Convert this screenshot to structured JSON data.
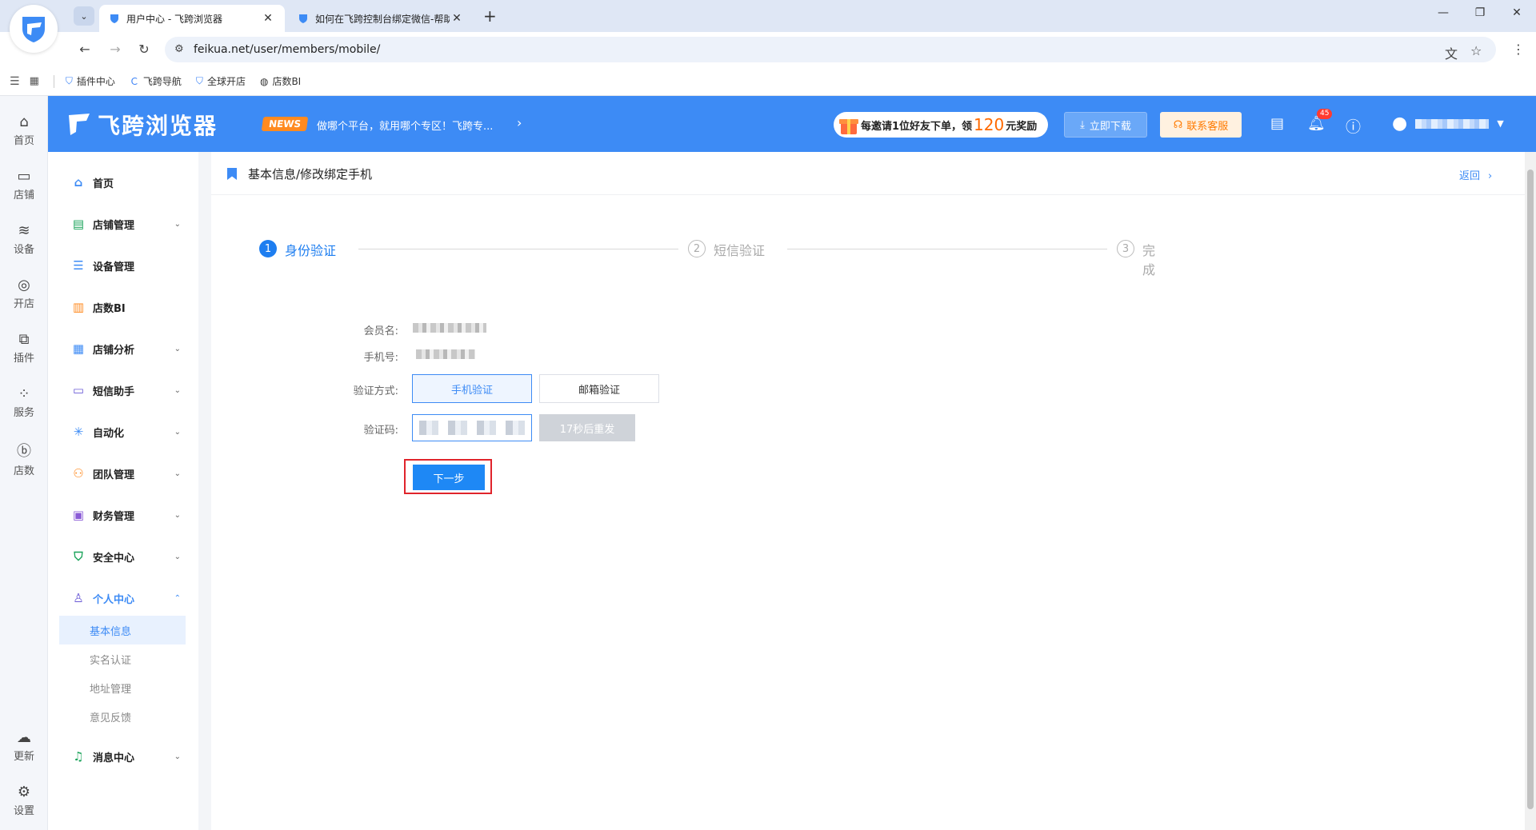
{
  "browser": {
    "tabs": [
      {
        "title": "用户中心 - 飞跨浏览器",
        "active": true
      },
      {
        "title": "如何在飞跨控制台绑定微信-帮助",
        "active": false
      }
    ],
    "url": "feikua.net/user/members/mobile/",
    "bookmarks": [
      "插件中心",
      "飞跨导航",
      "全球开店",
      "店数BI"
    ]
  },
  "header": {
    "brand": "飞跨浏览器",
    "news_badge": "NEWS",
    "news_text": "做哪个平台，就用哪个专区！飞跨专...",
    "invite_prefix": "每邀请1位好友下单，领",
    "invite_amount": "120",
    "invite_suffix": "元奖励",
    "download_label": "立即下载",
    "support_label": "联系客服",
    "notification_count": "45"
  },
  "rail": {
    "items": [
      "首页",
      "店铺",
      "设备",
      "开店",
      "插件",
      "服务",
      "店数"
    ],
    "bottom": [
      "更新",
      "设置"
    ]
  },
  "sidemenu": {
    "items": [
      {
        "label": "首页",
        "icon": "home-icon"
      },
      {
        "label": "店铺管理",
        "icon": "store-icon"
      },
      {
        "label": "设备管理",
        "icon": "server-icon"
      },
      {
        "label": "店数BI",
        "icon": "bar-chart-icon"
      },
      {
        "label": "店铺分析",
        "icon": "grid-icon"
      },
      {
        "label": "短信助手",
        "icon": "message-icon"
      },
      {
        "label": "自动化",
        "icon": "snowflake-icon"
      },
      {
        "label": "团队管理",
        "icon": "team-icon"
      },
      {
        "label": "财务管理",
        "icon": "wallet-icon"
      },
      {
        "label": "安全中心",
        "icon": "shield-check-icon"
      },
      {
        "label": "个人中心",
        "icon": "user-icon"
      },
      {
        "label": "消息中心",
        "icon": "bell-icon"
      }
    ],
    "sub_items": [
      "基本信息",
      "实名认证",
      "地址管理",
      "意见反馈"
    ]
  },
  "content": {
    "breadcrumb": "基本信息/修改绑定手机",
    "back_label": "返回",
    "steps": [
      {
        "num": "1",
        "label": "身份验证"
      },
      {
        "num": "2",
        "label": "短信验证"
      },
      {
        "num": "3",
        "label": "完成"
      }
    ],
    "form": {
      "member_label": "会员名:",
      "phone_label": "手机号:",
      "method_label": "验证方式:",
      "code_label": "验证码:",
      "method_phone": "手机验证",
      "method_email": "邮箱验证",
      "resend_label": "17秒后重发",
      "next_label": "下一步"
    }
  },
  "colors": {
    "brand_blue": "#3d8bf5",
    "highlight_red": "#e0242b",
    "accent_orange": "#ff7a00"
  }
}
